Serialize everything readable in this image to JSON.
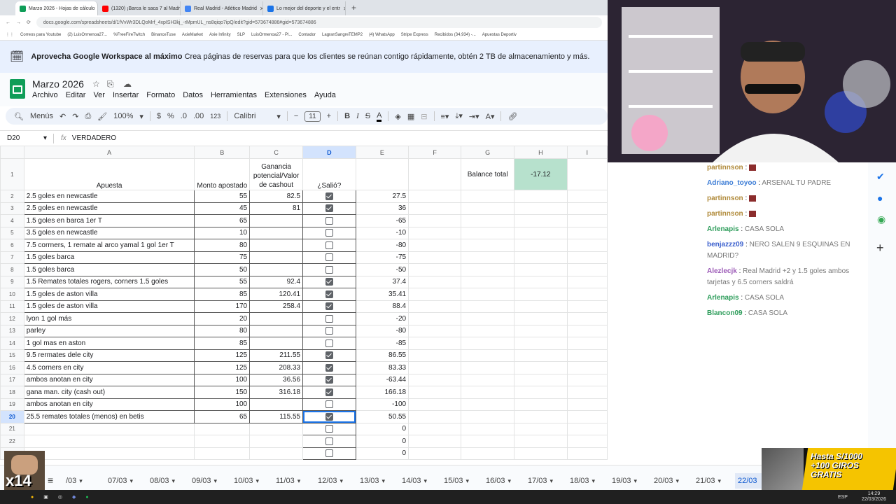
{
  "browser": {
    "tabs": [
      {
        "label": "Marzo 2026 - Hojas de cálculo",
        "color": "#0f9d58",
        "active": true
      },
      {
        "label": "(1320) ¡Barca le saca 7 al Madri",
        "color": "#ff0000",
        "active": false
      },
      {
        "label": "Real Madrid - Atlético Madrid",
        "color": "#4285f4",
        "active": false
      },
      {
        "label": "Lo mejor del deporte y el entr",
        "color": "#1a73e8",
        "active": false
      }
    ],
    "url": "docs.google.com/spreadsheets/d/1fVvWr3DLQoMrf_4xpISH3kj_-rMpmUL_ns8qiqo7ipQ/edit?gid=573674886#gid=573674886",
    "bookmarks": [
      "Correos para Youtube",
      "(2) LuisOrmenoa27...",
      "%FreeFireTwitch",
      "BinanceTuse",
      "AxieMarket",
      "Axie Infinity",
      "SLP",
      "LuisOrmenoa27 - Pl...",
      "Contador",
      "LagranSangreTEMP2",
      "(4) WhatsApp",
      "Stripe Express",
      "Recibidos (34,934) -...",
      "Apuestas Deportiv"
    ]
  },
  "banner": {
    "bold": "Aprovecha Google Workspace al máximo",
    "text": "Crea páginas de reservas para que los clientes se reúnan contigo rápidamente, obtén 2 TB de almacenamiento y más."
  },
  "doc": {
    "title": "Marzo 2026",
    "menus": [
      "Archivo",
      "Editar",
      "Ver",
      "Insertar",
      "Formato",
      "Datos",
      "Herramientas",
      "Extensiones",
      "Ayuda"
    ]
  },
  "toolbar": {
    "search": "Menús",
    "zoom": "100%",
    "currency": "$",
    "percent": "%",
    "dec_less": ".0",
    "dec_more": ".00",
    "num_format": "123",
    "font": "Calibri",
    "font_size": "11"
  },
  "formula_bar": {
    "cell_ref": "D20",
    "fx": "fx",
    "value": "VERDADERO"
  },
  "columns": [
    "A",
    "B",
    "C",
    "D",
    "E",
    "F",
    "G",
    "H",
    "I"
  ],
  "header_row": {
    "a": "Apuesta",
    "b": "Monto apostado",
    "c": "Ganancia potencial/Valor de cashout",
    "d": "¿Salió?",
    "g": "Balance total",
    "h": "-17.12"
  },
  "rows": [
    {
      "n": "2",
      "a": "2.5 goles en newcastle",
      "b": "55",
      "c": "82.5",
      "d": true,
      "e": "27.5"
    },
    {
      "n": "3",
      "a": "2.5 goles en newcastle",
      "b": "45",
      "c": "81",
      "d": true,
      "e": "36"
    },
    {
      "n": "4",
      "a": "1.5 goles en barca 1er T",
      "b": "65",
      "c": "",
      "d": false,
      "e": "-65"
    },
    {
      "n": "5",
      "a": "3.5 goles en newcastle",
      "b": "10",
      "c": "",
      "d": false,
      "e": "-10"
    },
    {
      "n": "6",
      "a": "7.5 corrners, 1 remate al arco yamal 1 gol 1er T",
      "b": "80",
      "c": "",
      "d": false,
      "e": "-80"
    },
    {
      "n": "7",
      "a": "1.5 goles barca",
      "b": "75",
      "c": "",
      "d": false,
      "e": "-75"
    },
    {
      "n": "8",
      "a": "1.5 goles barca",
      "b": "50",
      "c": "",
      "d": false,
      "e": "-50"
    },
    {
      "n": "9",
      "a": "1.5 Remates totales rogers, corners 1.5 goles",
      "b": "55",
      "c": "92.4",
      "d": true,
      "e": "37.4"
    },
    {
      "n": "10",
      "a": "1.5 goles de aston villa",
      "b": "85",
      "c": "120.41",
      "d": true,
      "e": "35.41"
    },
    {
      "n": "11",
      "a": "1.5 goles de aston villa",
      "b": "170",
      "c": "258.4",
      "d": true,
      "e": "88.4"
    },
    {
      "n": "12",
      "a": "lyon 1 gol más",
      "b": "20",
      "c": "",
      "d": false,
      "e": "-20"
    },
    {
      "n": "13",
      "a": "parley",
      "b": "80",
      "c": "",
      "d": false,
      "e": "-80"
    },
    {
      "n": "14",
      "a": "1 gol mas en aston",
      "b": "85",
      "c": "",
      "d": false,
      "e": "-85"
    },
    {
      "n": "15",
      "a": "9.5 rermates dele city",
      "b": "125",
      "c": "211.55",
      "d": true,
      "e": "86.55"
    },
    {
      "n": "16",
      "a": "4.5 corners en city",
      "b": "125",
      "c": "208.33",
      "d": true,
      "e": "83.33"
    },
    {
      "n": "17",
      "a": "ambos anotan en city",
      "b": "100",
      "c": "36.56",
      "d": true,
      "e": "-63.44"
    },
    {
      "n": "18",
      "a": "gana man. city (cash out)",
      "b": "150",
      "c": "316.18",
      "d": true,
      "e": "166.18"
    },
    {
      "n": "19",
      "a": "ambos anotan en city",
      "b": "100",
      "c": "",
      "d": false,
      "e": "-100"
    },
    {
      "n": "20",
      "a": "25.5 remates totales (menos) en betis",
      "b": "65",
      "c": "115.55",
      "d": true,
      "e": "50.55"
    },
    {
      "n": "21",
      "a": "",
      "b": "",
      "c": "",
      "d": false,
      "e": "0"
    },
    {
      "n": "22",
      "a": "",
      "b": "",
      "c": "",
      "d": false,
      "e": "0"
    },
    {
      "n": "23",
      "a": "",
      "b": "",
      "c": "",
      "d": false,
      "e": "0"
    }
  ],
  "sheet_tabs": [
    "/03",
    "07/03",
    "08/03",
    "09/03",
    "10/03",
    "11/03",
    "12/03",
    "13/03",
    "14/03",
    "15/03",
    "16/03",
    "17/03",
    "18/03",
    "19/03",
    "20/03",
    "21/03",
    "22/03"
  ],
  "chat": [
    {
      "user": "partinnson",
      "msg": "",
      "color": "#b08a3a"
    },
    {
      "user": "Adriano_toyoo",
      "msg": "ARSENAL TU PADRE",
      "color": "#3a7bd5"
    },
    {
      "user": "partinnson",
      "msg": "",
      "color": "#b08a3a"
    },
    {
      "user": "partinnson",
      "msg": "",
      "color": "#b08a3a"
    },
    {
      "user": "Arlenapis",
      "msg": "CASA SOLA",
      "color": "#2e9d5b"
    },
    {
      "user": "benjazzz09",
      "msg": "NERO SALEN 9 ESQUINAS EN MADRID?",
      "color": "#3a5fcd"
    },
    {
      "user": "Alezlecjk",
      "msg": "Real Madrid +2 y 1.5 goles ambos tarjetas y 6.5 corners saldrá",
      "color": "#9b59b6"
    },
    {
      "user": "Arlenapis",
      "msg": "CASA SOLA",
      "color": "#2e9d5b"
    },
    {
      "user": "Blancon09",
      "msg": "CASA SOLA",
      "color": "#2e9d5b"
    }
  ],
  "ad": {
    "line1": "Hasta S/1000",
    "line2": "+100 GIROS",
    "line3": "GRATIS"
  },
  "overlay": {
    "multiplier": "x14"
  },
  "clock": {
    "time": "14:29",
    "date": "22/03/2026",
    "lang": "ESP"
  },
  "colors": {
    "accent": "#0b57d0",
    "balance_bg": "#b7e1cd",
    "sheets_green": "#0f9d58"
  }
}
